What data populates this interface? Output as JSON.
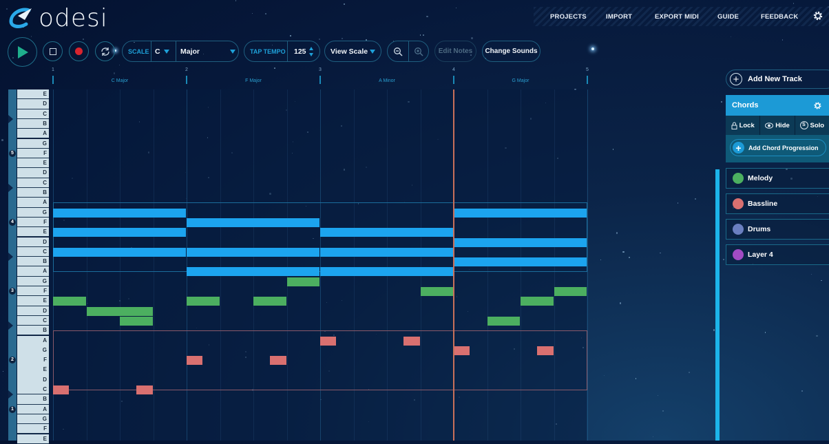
{
  "app": {
    "name": "odesi"
  },
  "nav": {
    "items": [
      "PROJECTS",
      "IMPORT",
      "EXPORT MIDI",
      "GUIDE",
      "FEEDBACK"
    ]
  },
  "toolbar": {
    "scale_label": "SCALE",
    "scale_key": "C",
    "scale_mode": "Major",
    "tap_tempo_label": "TAP TEMPO",
    "tempo": "125",
    "view_scale": "View Scale",
    "edit_notes": "Edit Notes",
    "change_sounds": "Change Sounds"
  },
  "ruler": {
    "bars": [
      "1",
      "2",
      "3",
      "4",
      "5"
    ],
    "chords": [
      "C Major",
      "F Major",
      "A Minor",
      "G Major"
    ]
  },
  "keyboard": {
    "rows": [
      "E",
      "D",
      "C",
      "B",
      "A",
      "G",
      "F",
      "E",
      "D",
      "C",
      "B",
      "A",
      "G",
      "F",
      "E",
      "D",
      "C",
      "B",
      "A",
      "G",
      "F",
      "E",
      "D",
      "C",
      "B",
      "A",
      "G",
      "F",
      "E",
      "D",
      "C",
      "B",
      "A",
      "G",
      "F",
      "E"
    ],
    "octaves": [
      {
        "label": "5",
        "row": 6.5
      },
      {
        "label": "4",
        "row": 13.5
      },
      {
        "label": "3",
        "row": 20.5
      },
      {
        "label": "2",
        "row": 27.5
      },
      {
        "label": "1",
        "row": 32.5
      }
    ]
  },
  "playhead_beat": 12,
  "colors": {
    "chords": "#1ca4ef",
    "melody": "#4caf60",
    "bassline": "#d97070",
    "drums": "#6a7fc0",
    "layer4": "#a24bc4",
    "accent": "#1ea0d8"
  },
  "notes": {
    "chords": [
      {
        "row": 12,
        "start": 0,
        "len": 4
      },
      {
        "row": 14,
        "start": 0,
        "len": 4
      },
      {
        "row": 16,
        "start": 0,
        "len": 4
      },
      {
        "row": 13,
        "start": 4,
        "len": 4
      },
      {
        "row": 16,
        "start": 4,
        "len": 4
      },
      {
        "row": 18,
        "start": 4,
        "len": 4
      },
      {
        "row": 14,
        "start": 8,
        "len": 4
      },
      {
        "row": 16,
        "start": 8,
        "len": 4
      },
      {
        "row": 18,
        "start": 8,
        "len": 4
      },
      {
        "row": 12,
        "start": 12,
        "len": 4
      },
      {
        "row": 15,
        "start": 12,
        "len": 4
      },
      {
        "row": 17,
        "start": 12,
        "len": 4
      }
    ],
    "melody": [
      {
        "row": 21,
        "start": 0,
        "len": 1
      },
      {
        "row": 22,
        "start": 1,
        "len": 2
      },
      {
        "row": 23,
        "start": 2,
        "len": 1
      },
      {
        "row": 21,
        "start": 4,
        "len": 1
      },
      {
        "row": 21,
        "start": 6,
        "len": 1
      },
      {
        "row": 19,
        "start": 7,
        "len": 1
      },
      {
        "row": 20,
        "start": 11,
        "len": 1
      },
      {
        "row": 23,
        "start": 13,
        "len": 1
      },
      {
        "row": 21,
        "start": 14,
        "len": 1
      },
      {
        "row": 20,
        "start": 15,
        "len": 1
      }
    ],
    "bassline": [
      {
        "row": 30,
        "start": 0,
        "len": 0.5
      },
      {
        "row": 30,
        "start": 2.5,
        "len": 0.5
      },
      {
        "row": 27,
        "start": 4,
        "len": 0.5
      },
      {
        "row": 27,
        "start": 6.5,
        "len": 0.5
      },
      {
        "row": 25,
        "start": 8,
        "len": 0.5
      },
      {
        "row": 25,
        "start": 10.5,
        "len": 0.5
      },
      {
        "row": 26,
        "start": 12,
        "len": 0.5
      },
      {
        "row": 26,
        "start": 14.5,
        "len": 0.5
      }
    ]
  },
  "panel": {
    "add_track": "Add New Track",
    "selected_track": "Chords",
    "tools": [
      "Lock",
      "Hide",
      "Solo"
    ],
    "add_progression": "Add Chord Progression",
    "tracks": [
      {
        "name": "Melody",
        "color": "#4caf60"
      },
      {
        "name": "Bassline",
        "color": "#d97070"
      },
      {
        "name": "Drums",
        "color": "#6a7fc0"
      },
      {
        "name": "Layer 4",
        "color": "#a24bc4"
      }
    ]
  }
}
